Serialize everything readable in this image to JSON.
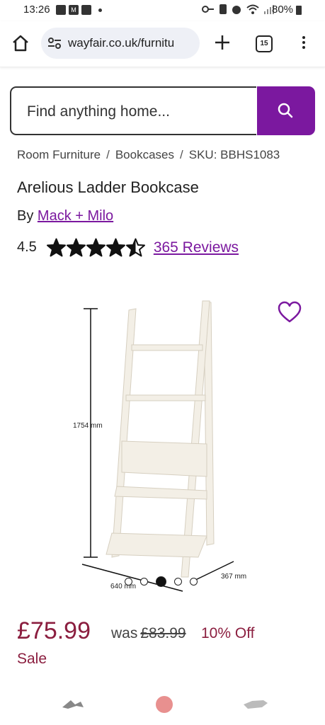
{
  "status_bar": {
    "time": "13:26",
    "battery": "80%"
  },
  "browser": {
    "url": "wayfair.co.uk/furnitu",
    "tab_count": "15"
  },
  "search": {
    "placeholder": "Find anything home..."
  },
  "breadcrumb": {
    "items": [
      "Room Furniture",
      "Bookcases"
    ],
    "sku": "SKU: BBHS1083"
  },
  "product": {
    "title": "Arelious Ladder Bookcase",
    "by_label": "By",
    "brand": "Mack + Milo",
    "rating": "4.5",
    "rating_value": 4.5,
    "reviews": "365 Reviews",
    "image_dims": {
      "height": "1754 mm",
      "width": "640 mm",
      "depth": "367 mm"
    },
    "carousel": {
      "count": 5,
      "active": 3
    }
  },
  "pricing": {
    "price": "£75.99",
    "was_label": "was",
    "was_price": "£83.99",
    "discount": "10% Off",
    "sale_label": "Sale"
  },
  "colors": {
    "brand_purple": "#7b189f",
    "price_red": "#8b1e3f"
  },
  "icons": [
    "home-icon",
    "tune-icon",
    "plus-icon",
    "tabs-icon",
    "menu-icon",
    "search-icon",
    "star-icon",
    "heart-icon"
  ]
}
